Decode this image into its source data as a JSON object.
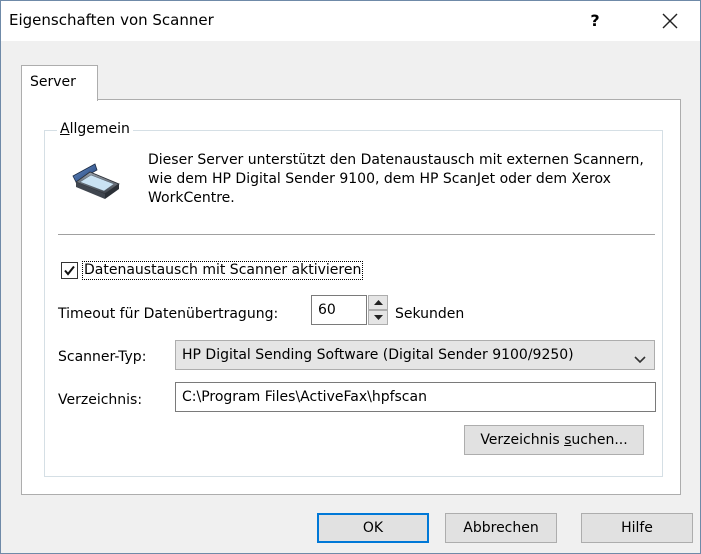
{
  "window": {
    "title": "Eigenschaften von Scanner",
    "help_label": "?"
  },
  "tabs": [
    {
      "label": "Server",
      "selected": true
    }
  ],
  "group": {
    "legend_first": "A",
    "legend_rest": "llgemein",
    "description": "Dieser Server unterstützt den Datenaustausch mit externen Scannern, wie dem HP Digital Sender 9100, dem HP ScanJet oder dem Xerox WorkCentre.",
    "icon": "scanner-icon"
  },
  "form": {
    "enable_exchange": {
      "label": "Datenaustausch mit Scanner aktivieren",
      "checked": true
    },
    "timeout": {
      "label": "Timeout für Datenübertragung:",
      "value": "60",
      "unit": "Sekunden"
    },
    "scanner_type": {
      "label": "Scanner-Typ:",
      "value": "HP Digital Sending Software (Digital Sender 9100/9250)"
    },
    "directory": {
      "label": "Verzeichnis:",
      "value": "C:\\Program Files\\ActiveFax\\hpfscan"
    },
    "browse": {
      "label_pre": "Verzeichnis ",
      "label_underlined": "s",
      "label_post": "uchen..."
    }
  },
  "buttons": {
    "ok": "OK",
    "cancel": "Abbrechen",
    "help": "Hilfe"
  },
  "colors": {
    "dialog_bg": "#f0f0f0",
    "panel_bg": "#ffffff",
    "accent": "#0078d7"
  }
}
